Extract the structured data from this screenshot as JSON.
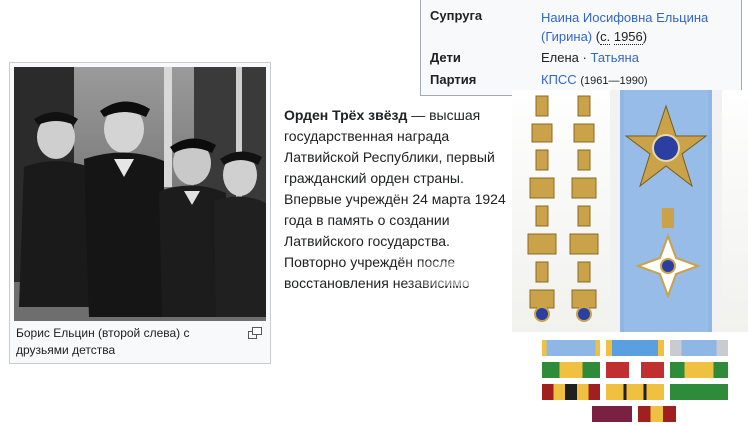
{
  "infobox": {
    "rows": [
      {
        "label": "Супруга",
        "value": "Наина Иосифовна Ельцина (Гирина)",
        "value_line1": "Наина Иосифовна Ельцина",
        "value_line2": "(Гирина)",
        "extra_open": " (",
        "extra_abbr": "с.",
        "extra_year": "1956",
        "extra_close": ")"
      },
      {
        "label": "Дети",
        "child1": "Елена",
        "sep": " · ",
        "child2": "Татьяна"
      },
      {
        "label": "Партия",
        "party": "КПСС",
        "years": "(1961—1990)"
      }
    ]
  },
  "photo": {
    "caption": "Борис Ельцин (второй слева) с друзьями детства"
  },
  "article": {
    "bold": "Орден Трёх звёзд",
    "text": " — высшая государственная награда Латвийской Республики, первый гражданский орден страны. Впервые учреждён 24 марта 1924 года в память о создании Латвийского государства. Повторно учреждён после восстановления независимо"
  },
  "colors": {
    "link": "#3366cc",
    "infobox_bg": "#f8f9fa",
    "infobox_border": "#a2a9b1",
    "ribbon_blue": "#8fb7e6",
    "gold": "#c9a24a"
  },
  "icons": {
    "magnify": "magnify-icon"
  }
}
